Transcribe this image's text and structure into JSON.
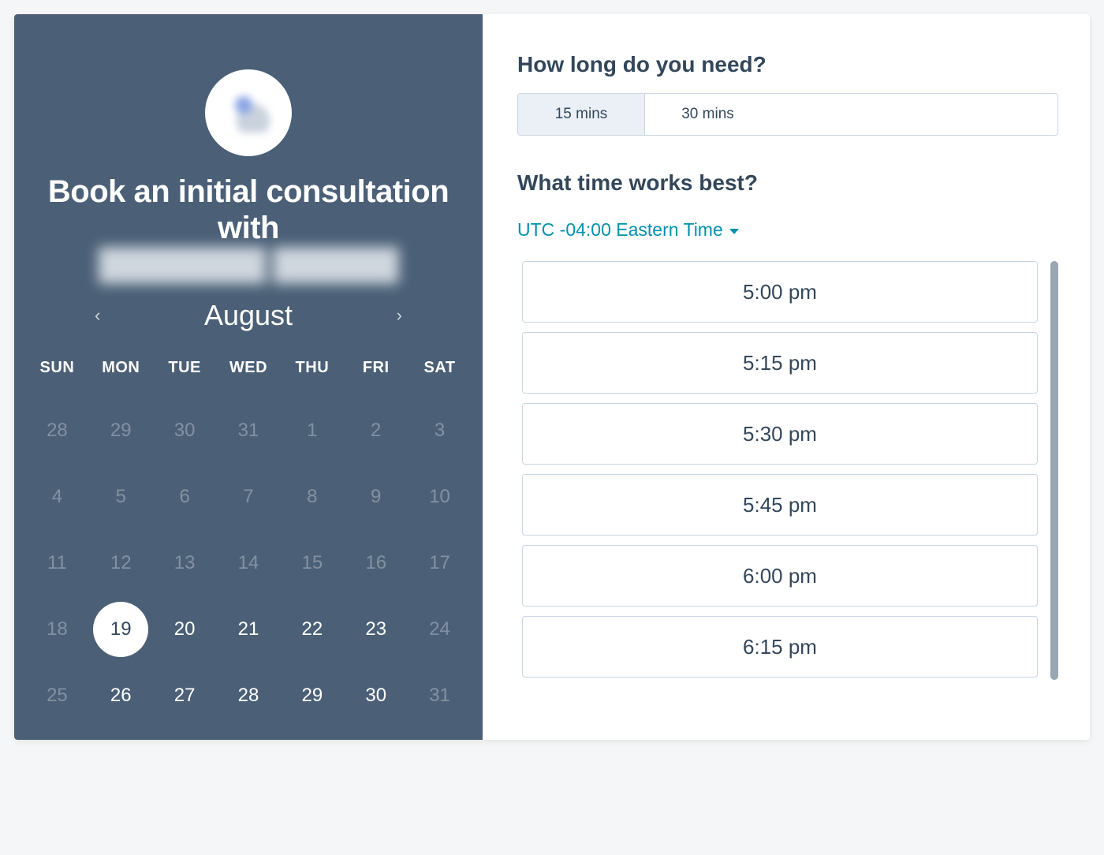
{
  "left": {
    "title_line1": "Book an initial consultation with",
    "title_line2_obscured": "████████ ██████",
    "month": "August",
    "dow": [
      "SUN",
      "MON",
      "TUE",
      "WED",
      "THU",
      "FRI",
      "SAT"
    ],
    "weeks": [
      [
        {
          "n": "28",
          "state": "muted"
        },
        {
          "n": "29",
          "state": "muted"
        },
        {
          "n": "30",
          "state": "muted"
        },
        {
          "n": "31",
          "state": "muted"
        },
        {
          "n": "1",
          "state": "muted"
        },
        {
          "n": "2",
          "state": "muted"
        },
        {
          "n": "3",
          "state": "muted"
        }
      ],
      [
        {
          "n": "4",
          "state": "muted"
        },
        {
          "n": "5",
          "state": "muted"
        },
        {
          "n": "6",
          "state": "muted"
        },
        {
          "n": "7",
          "state": "muted"
        },
        {
          "n": "8",
          "state": "muted"
        },
        {
          "n": "9",
          "state": "muted"
        },
        {
          "n": "10",
          "state": "muted"
        }
      ],
      [
        {
          "n": "11",
          "state": "muted"
        },
        {
          "n": "12",
          "state": "muted"
        },
        {
          "n": "13",
          "state": "muted"
        },
        {
          "n": "14",
          "state": "muted"
        },
        {
          "n": "15",
          "state": "muted"
        },
        {
          "n": "16",
          "state": "muted"
        },
        {
          "n": "17",
          "state": "muted"
        }
      ],
      [
        {
          "n": "18",
          "state": "muted"
        },
        {
          "n": "19",
          "state": "selected"
        },
        {
          "n": "20",
          "state": "avail"
        },
        {
          "n": "21",
          "state": "avail"
        },
        {
          "n": "22",
          "state": "avail"
        },
        {
          "n": "23",
          "state": "avail"
        },
        {
          "n": "24",
          "state": "muted"
        }
      ],
      [
        {
          "n": "25",
          "state": "muted"
        },
        {
          "n": "26",
          "state": "avail"
        },
        {
          "n": "27",
          "state": "avail"
        },
        {
          "n": "28",
          "state": "avail"
        },
        {
          "n": "29",
          "state": "avail"
        },
        {
          "n": "30",
          "state": "avail"
        },
        {
          "n": "31",
          "state": "muted"
        }
      ]
    ]
  },
  "right": {
    "duration_question": "How long do you need?",
    "durations": [
      {
        "label": "15 mins",
        "selected": true
      },
      {
        "label": "30 mins",
        "selected": false
      }
    ],
    "time_question": "What time works best?",
    "timezone": "UTC -04:00 Eastern Time",
    "slots": [
      "5:00 pm",
      "5:15 pm",
      "5:30 pm",
      "5:45 pm",
      "6:00 pm",
      "6:15 pm"
    ]
  }
}
